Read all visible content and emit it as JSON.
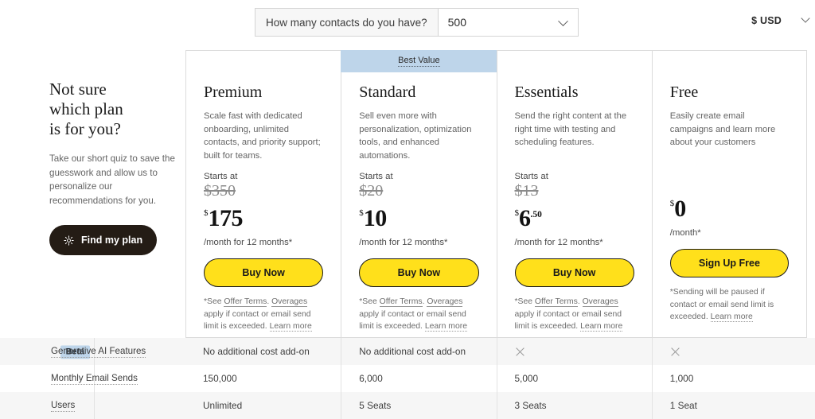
{
  "header": {
    "contacts_label": "How many contacts do you have?",
    "contacts_value": "500",
    "currency": "$ USD"
  },
  "promo": {
    "title_line1": "Not sure",
    "title_line2": "which plan",
    "title_line3": "is for you?",
    "body": "Take our short quiz to save the guesswork and allow us to personalize our recommendations for you.",
    "button_label": "Find my plan",
    "button_icon": "sparkle-icon",
    "button_color": "#241c15"
  },
  "plans": [
    {
      "name": "Premium",
      "description": "Scale fast with dedicated onboarding, unlimited contacts, and priority support; built for teams.",
      "starts_at": "Starts at",
      "price_old": "$350",
      "currency_symbol": "$",
      "price_amount": "175",
      "price_cents": "",
      "price_note": "/month for 12 months*",
      "cta_label": "Buy Now",
      "fine_print": {
        "prefix": "*See ",
        "link1": "Offer Terms",
        "mid1": ". ",
        "link2": "Overages",
        "mid2": " apply if contact or email send limit is exceeded. ",
        "link3": "Learn more"
      },
      "badge": null
    },
    {
      "name": "Standard",
      "description": "Sell even more with personalization, optimization tools, and enhanced automations.",
      "starts_at": "Starts at",
      "price_old": "$20",
      "currency_symbol": "$",
      "price_amount": "10",
      "price_cents": "",
      "price_note": "/month for 12 months*",
      "cta_label": "Buy Now",
      "fine_print": {
        "prefix": "*See ",
        "link1": "Offer Terms",
        "mid1": ". ",
        "link2": "Overages",
        "mid2": " apply if contact or email send limit is exceeded. ",
        "link3": "Learn more"
      },
      "badge": "Best Value"
    },
    {
      "name": "Essentials",
      "description": "Send the right content at the right time with testing and scheduling features.",
      "starts_at": "Starts at",
      "price_old": "$13",
      "currency_symbol": "$",
      "price_amount": "6",
      "price_cents": ".50",
      "price_note": "/month for 12 months*",
      "cta_label": "Buy Now",
      "fine_print": {
        "prefix": "*See ",
        "link1": "Offer Terms",
        "mid1": ". ",
        "link2": "Overages",
        "mid2": " apply if contact or email send limit is exceeded. ",
        "link3": "Learn more"
      },
      "badge": null
    },
    {
      "name": "Free",
      "description": "Easily create email campaigns and learn more about your customers",
      "starts_at": "",
      "price_old": "",
      "currency_symbol": "$",
      "price_amount": "0",
      "price_cents": "",
      "price_note": "/month*",
      "cta_label": "Sign Up Free",
      "fine_print": {
        "prefix": "*Sending will be paused if contact or email send limit is exceeded. ",
        "link1": "",
        "mid1": "",
        "link2": "",
        "mid2": "",
        "link3": "Learn more"
      },
      "badge": null
    }
  ],
  "comparison": {
    "rows": [
      {
        "badge": "Beta",
        "feature": "Generative AI Features",
        "values": [
          "No additional cost add-on",
          "No additional cost add-on",
          "x-icon",
          "x-icon"
        ]
      },
      {
        "badge": "",
        "feature": "Monthly Email Sends",
        "values": [
          "150,000",
          "6,000",
          "5,000",
          "1,000"
        ]
      },
      {
        "badge": "",
        "feature": "Users",
        "values": [
          "Unlimited",
          "5 Seats",
          "3 Seats",
          "1 Seat"
        ]
      }
    ]
  },
  "colors": {
    "cta_yellow": "#ffe01b",
    "banner_blue": "#bed5ea",
    "dark": "#241c15"
  }
}
